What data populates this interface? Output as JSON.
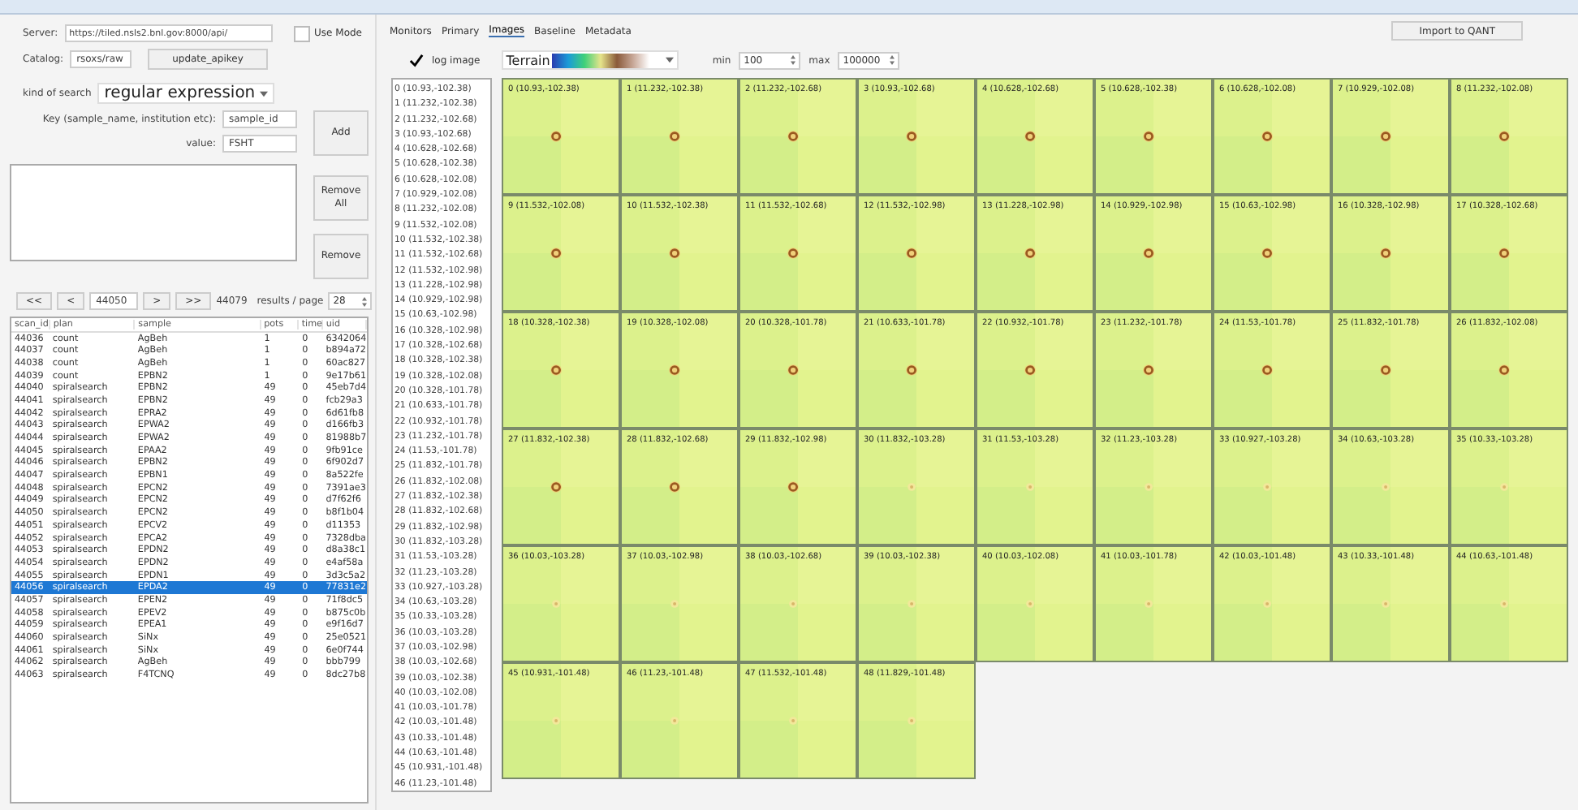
{
  "search_panel": {
    "server_label": "Server:",
    "server": "https://tiled.nsls2.bnl.gov:8000/api/",
    "use_mode": {
      "label": "Use Mode",
      "checked": false
    },
    "catalog_label": "Catalog:",
    "catalog": "rsoxs/raw",
    "update_button": "update_apikey",
    "kind_label": "kind of search",
    "kind": "regular expression",
    "key_label": "Key (sample_name, institution etc):",
    "key": "sample_id",
    "value_label": "value:",
    "value": "FSHT",
    "buttons": [
      "Add",
      "Remove All",
      "Remove"
    ]
  },
  "pager": {
    "first": "<<",
    "prev": "<",
    "start": "44050",
    "next": ">",
    "last": ">>",
    "end": "44079",
    "per_page_label": "results / page",
    "per_page": "28"
  },
  "table": {
    "columns": [
      "scan_id",
      "plan",
      "sample",
      "pots",
      "time",
      "uid"
    ],
    "rows": [
      {
        "cells": [
          "44036",
          "count",
          "AgBeh",
          "1",
          "0",
          "6342064"
        ],
        "selected": false
      },
      {
        "cells": [
          "44037",
          "count",
          "AgBeh",
          "1",
          "0",
          "b894a72"
        ],
        "selected": false
      },
      {
        "cells": [
          "44038",
          "count",
          "AgBeh",
          "1",
          "0",
          "60ac827"
        ],
        "selected": false
      },
      {
        "cells": [
          "44039",
          "count",
          "EPBN2",
          "1",
          "0",
          "9e17b61"
        ],
        "selected": false
      },
      {
        "cells": [
          "44040",
          "spiralsearch",
          "EPBN2",
          "49",
          "0",
          "45eb7d4"
        ],
        "selected": false
      },
      {
        "cells": [
          "44041",
          "spiralsearch",
          "EPBN2",
          "49",
          "0",
          "fcb29a3"
        ],
        "selected": false
      },
      {
        "cells": [
          "44042",
          "spiralsearch",
          "EPRA2",
          "49",
          "0",
          "6d61fb8"
        ],
        "selected": false
      },
      {
        "cells": [
          "44043",
          "spiralsearch",
          "EPWA2",
          "49",
          "0",
          "d166fb3"
        ],
        "selected": false
      },
      {
        "cells": [
          "44044",
          "spiralsearch",
          "EPWA2",
          "49",
          "0",
          "81988b7"
        ],
        "selected": false
      },
      {
        "cells": [
          "44045",
          "spiralsearch",
          "EPAA2",
          "49",
          "0",
          "9fb91ce"
        ],
        "selected": false
      },
      {
        "cells": [
          "44046",
          "spiralsearch",
          "EPBN2",
          "49",
          "0",
          "6f902d7"
        ],
        "selected": false
      },
      {
        "cells": [
          "44047",
          "spiralsearch",
          "EPBN1",
          "49",
          "0",
          "8a522fe"
        ],
        "selected": false
      },
      {
        "cells": [
          "44048",
          "spiralsearch",
          "EPCN2",
          "49",
          "0",
          "7391ae3"
        ],
        "selected": false
      },
      {
        "cells": [
          "44049",
          "spiralsearch",
          "EPCN2",
          "49",
          "0",
          "d7f62f6"
        ],
        "selected": false
      },
      {
        "cells": [
          "44050",
          "spiralsearch",
          "EPCN2",
          "49",
          "0",
          "b8f1b04"
        ],
        "selected": false
      },
      {
        "cells": [
          "44051",
          "spiralsearch",
          "EPCV2",
          "49",
          "0",
          "d11353"
        ],
        "selected": false
      },
      {
        "cells": [
          "44052",
          "spiralsearch",
          "EPCA2",
          "49",
          "0",
          "7328dba"
        ],
        "selected": false
      },
      {
        "cells": [
          "44053",
          "spiralsearch",
          "EPDN2",
          "49",
          "0",
          "d8a38c1"
        ],
        "selected": false
      },
      {
        "cells": [
          "44054",
          "spiralsearch",
          "EPDN2",
          "49",
          "0",
          "e4af58a"
        ],
        "selected": false
      },
      {
        "cells": [
          "44055",
          "spiralsearch",
          "EPDN1",
          "49",
          "0",
          "3d3c5a2"
        ],
        "selected": false
      },
      {
        "cells": [
          "44056",
          "spiralsearch",
          "EPDA2",
          "49",
          "0",
          "77831e2"
        ],
        "selected": true
      },
      {
        "cells": [
          "44057",
          "spiralsearch",
          "EPEN2",
          "49",
          "0",
          "71f8dc5"
        ],
        "selected": false
      },
      {
        "cells": [
          "44058",
          "spiralsearch",
          "EPEV2",
          "49",
          "0",
          "b875c0b"
        ],
        "selected": false
      },
      {
        "cells": [
          "44059",
          "spiralsearch",
          "EPEA1",
          "49",
          "0",
          "e9f16d7"
        ],
        "selected": false
      },
      {
        "cells": [
          "44060",
          "spiralsearch",
          "SiNx",
          "49",
          "0",
          "25e0521"
        ],
        "selected": false
      },
      {
        "cells": [
          "44061",
          "spiralsearch",
          "SiNx",
          "49",
          "0",
          "6e0f744"
        ],
        "selected": false
      },
      {
        "cells": [
          "44062",
          "spiralsearch",
          "AgBeh",
          "49",
          "0",
          "bbb799"
        ],
        "selected": false
      },
      {
        "cells": [
          "44063",
          "spiralsearch",
          "F4TCNQ",
          "49",
          "0",
          "8dc27b8"
        ],
        "selected": false
      }
    ]
  },
  "tabs": [
    {
      "label": "Monitors",
      "selected": false
    },
    {
      "label": "Primary",
      "selected": false
    },
    {
      "label": "Images",
      "selected": true
    },
    {
      "label": "Baseline",
      "selected": false
    },
    {
      "label": "Metadata",
      "selected": false
    }
  ],
  "import_button": "Import to QANT",
  "image_controls": {
    "log_image": {
      "label": "log image",
      "checked": true
    },
    "colormap": "Terrain",
    "min_label": "min",
    "min": "100",
    "max_label": "max",
    "max": "100000"
  },
  "position_list": [
    "0 (10.93,-102.38)",
    "1 (11.232,-102.38)",
    "2 (11.232,-102.68)",
    "3 (10.93,-102.68)",
    "4 (10.628,-102.68)",
    "5 (10.628,-102.38)",
    "6 (10.628,-102.08)",
    "7 (10.929,-102.08)",
    "8 (11.232,-102.08)",
    "9 (11.532,-102.08)",
    "10 (11.532,-102.38)",
    "11 (11.532,-102.68)",
    "12 (11.532,-102.98)",
    "13 (11.228,-102.98)",
    "14 (10.929,-102.98)",
    "15 (10.63,-102.98)",
    "16 (10.328,-102.98)",
    "17 (10.328,-102.68)",
    "18 (10.328,-102.38)",
    "19 (10.328,-102.08)",
    "20 (10.328,-101.78)",
    "21 (10.633,-101.78)",
    "22 (10.932,-101.78)",
    "23 (11.232,-101.78)",
    "24 (11.53,-101.78)",
    "25 (11.832,-101.78)",
    "26 (11.832,-102.08)",
    "27 (11.832,-102.38)",
    "28 (11.832,-102.68)",
    "29 (11.832,-102.98)",
    "30 (11.832,-103.28)",
    "31 (11.53,-103.28)",
    "32 (11.23,-103.28)",
    "33 (10.927,-103.28)",
    "34 (10.63,-103.28)",
    "35 (10.33,-103.28)",
    "36 (10.03,-103.28)",
    "37 (10.03,-102.98)",
    "38 (10.03,-102.68)",
    "39 (10.03,-102.38)",
    "40 (10.03,-102.08)",
    "41 (10.03,-101.78)",
    "42 (10.03,-101.48)",
    "43 (10.33,-101.48)",
    "44 (10.63,-101.48)",
    "45 (10.931,-101.48)",
    "46 (11.23,-101.48)"
  ],
  "tiles": [
    {
      "label": "0 (10.93,-102.38)",
      "kind": "ring"
    },
    {
      "label": "1 (11.232,-102.38)",
      "kind": "ring"
    },
    {
      "label": "2 (11.232,-102.68)",
      "kind": "ring"
    },
    {
      "label": "3 (10.93,-102.68)",
      "kind": "ring"
    },
    {
      "label": "4 (10.628,-102.68)",
      "kind": "ring"
    },
    {
      "label": "5 (10.628,-102.38)",
      "kind": "ring"
    },
    {
      "label": "6 (10.628,-102.08)",
      "kind": "ring"
    },
    {
      "label": "7 (10.929,-102.08)",
      "kind": "ring"
    },
    {
      "label": "8 (11.232,-102.08)",
      "kind": "ring"
    },
    {
      "label": "9 (11.532,-102.08)",
      "kind": "ring"
    },
    {
      "label": "10 (11.532,-102.38)",
      "kind": "ring"
    },
    {
      "label": "11 (11.532,-102.68)",
      "kind": "ring"
    },
    {
      "label": "12 (11.532,-102.98)",
      "kind": "ring"
    },
    {
      "label": "13 (11.228,-102.98)",
      "kind": "ring"
    },
    {
      "label": "14 (10.929,-102.98)",
      "kind": "ring"
    },
    {
      "label": "15 (10.63,-102.98)",
      "kind": "ring"
    },
    {
      "label": "16 (10.328,-102.98)",
      "kind": "ring"
    },
    {
      "label": "17 (10.328,-102.68)",
      "kind": "ring"
    },
    {
      "label": "18 (10.328,-102.38)",
      "kind": "ring"
    },
    {
      "label": "19 (10.328,-102.08)",
      "kind": "ring"
    },
    {
      "label": "20 (10.328,-101.78)",
      "kind": "ring"
    },
    {
      "label": "21 (10.633,-101.78)",
      "kind": "ring"
    },
    {
      "label": "22 (10.932,-101.78)",
      "kind": "ring"
    },
    {
      "label": "23 (11.232,-101.78)",
      "kind": "ring"
    },
    {
      "label": "24 (11.53,-101.78)",
      "kind": "ring"
    },
    {
      "label": "25 (11.832,-101.78)",
      "kind": "ring"
    },
    {
      "label": "26 (11.832,-102.08)",
      "kind": "ring"
    },
    {
      "label": "27 (11.832,-102.38)",
      "kind": "ring"
    },
    {
      "label": "28 (11.832,-102.68)",
      "kind": "ring"
    },
    {
      "label": "29 (11.832,-102.98)",
      "kind": "ring"
    },
    {
      "label": "30 (11.832,-103.28)",
      "kind": "faint"
    },
    {
      "label": "31 (11.53,-103.28)",
      "kind": "faint"
    },
    {
      "label": "32 (11.23,-103.28)",
      "kind": "faint"
    },
    {
      "label": "33 (10.927,-103.28)",
      "kind": "faint"
    },
    {
      "label": "34 (10.63,-103.28)",
      "kind": "faint"
    },
    {
      "label": "35 (10.33,-103.28)",
      "kind": "faint"
    },
    {
      "label": "36 (10.03,-103.28)",
      "kind": "faint"
    },
    {
      "label": "37 (10.03,-102.98)",
      "kind": "faint"
    },
    {
      "label": "38 (10.03,-102.68)",
      "kind": "faint"
    },
    {
      "label": "39 (10.03,-102.38)",
      "kind": "faint"
    },
    {
      "label": "40 (10.03,-102.08)",
      "kind": "faint"
    },
    {
      "label": "41 (10.03,-101.78)",
      "kind": "faint"
    },
    {
      "label": "42 (10.03,-101.48)",
      "kind": "faint"
    },
    {
      "label": "43 (10.33,-101.48)",
      "kind": "faint"
    },
    {
      "label": "44 (10.63,-101.48)",
      "kind": "faint"
    },
    {
      "label": "45 (10.931,-101.48)",
      "kind": "faint"
    },
    {
      "label": "46 (11.23,-101.48)",
      "kind": "faint"
    },
    {
      "label": "47 (11.532,-101.48)",
      "kind": "faint"
    },
    {
      "label": "48 (11.829,-101.48)",
      "kind": "faint"
    }
  ]
}
